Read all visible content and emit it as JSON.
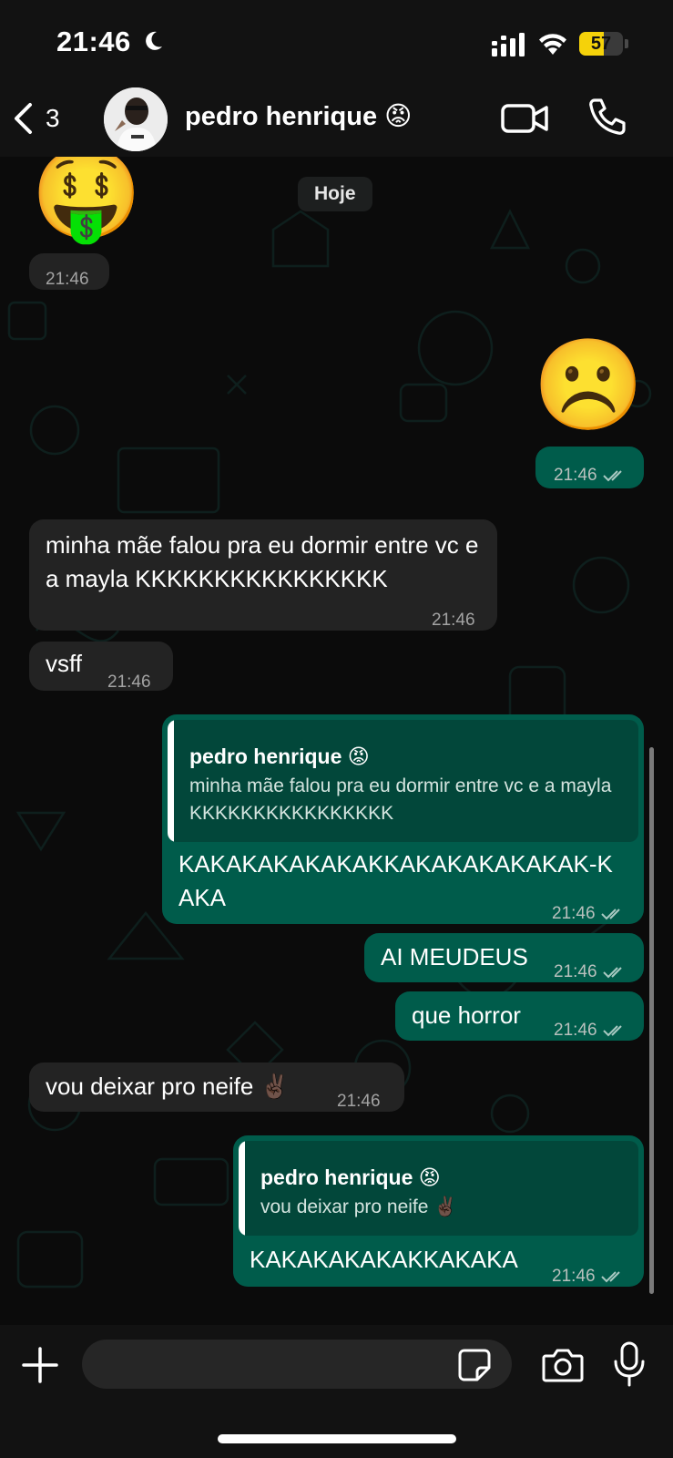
{
  "status_bar": {
    "time": "21:46",
    "battery": "57",
    "battery_level": 0.57
  },
  "header": {
    "back_count": "3",
    "contact_name": "pedro henrique 😡",
    "icons": [
      "chevron-left-icon",
      "avatar",
      "video-call-icon",
      "phone-icon"
    ]
  },
  "chat": {
    "date_chip": "Hoje",
    "messages": [
      {
        "direction": "in",
        "emoji": "🤑",
        "time": "21:46"
      },
      {
        "direction": "out",
        "emoji": "☹️",
        "time": "21:46",
        "status": "read"
      },
      {
        "direction": "in",
        "text": "minha mãe falou pra eu dormir entre vc e a mayla KKKKKKKKKKKKKKKK",
        "time": "21:46"
      },
      {
        "direction": "in",
        "text": "vsff",
        "time": "21:46"
      },
      {
        "direction": "out",
        "reply_name": "pedro henrique 😡",
        "reply_text": "minha mãe falou pra eu dormir entre vc e a mayla KKKKKKKKKKKKKKKK",
        "text": "KAKAKAKAKAKAKKAKAKAKAKAKAK-KAKA",
        "time": "21:46",
        "status": "read"
      },
      {
        "direction": "out",
        "text": "AI MEUDEUS",
        "time": "21:46",
        "status": "read"
      },
      {
        "direction": "out",
        "text": "que horror",
        "time": "21:46",
        "status": "read"
      },
      {
        "direction": "in",
        "text": "vou deixar pro neife ✌🏿",
        "time": "21:46"
      },
      {
        "direction": "out",
        "reply_name": "pedro henrique 😡",
        "reply_text": "vou deixar pro neife ✌🏿",
        "text": "KAKAKAKAKAKKAKAKA",
        "time": "21:46",
        "status": "read"
      }
    ]
  },
  "input": {
    "placeholder": "",
    "icons": [
      "plus-icon",
      "sticker-icon",
      "camera-icon",
      "microphone-icon"
    ]
  },
  "colors": {
    "incoming_bubble": "#232323",
    "outgoing_bubble": "#005c4b",
    "reply_box": "#02473a",
    "background": "#0b0b0b"
  }
}
